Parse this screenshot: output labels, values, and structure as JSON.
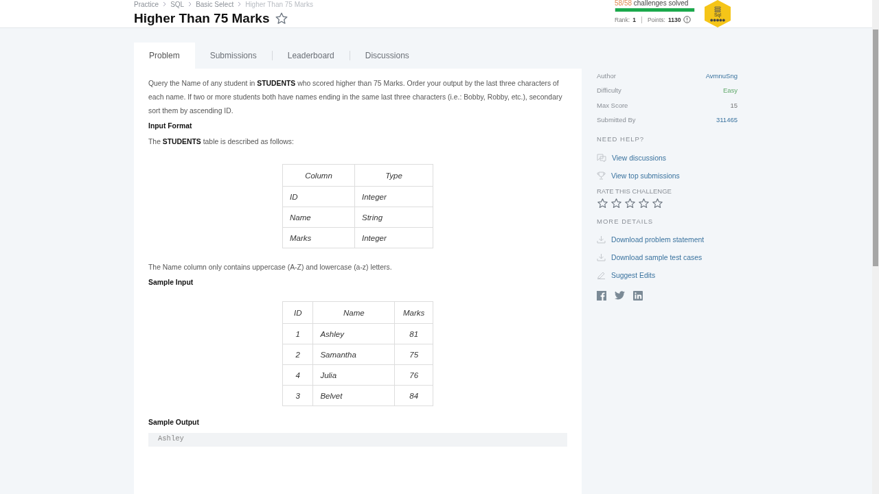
{
  "breadcrumb": [
    {
      "label": "Practice"
    },
    {
      "label": "SQL"
    },
    {
      "label": "Basic Select"
    },
    {
      "label": "Higher Than 75 Marks",
      "current": true
    }
  ],
  "title": "Higher Than 75 Marks",
  "stats": {
    "solved": "58/58",
    "solved_label": "challenges solved",
    "level": 1,
    "rank_label": "Rank:",
    "rank": "1",
    "points_label": "Points:",
    "points": "1130"
  },
  "badge": {
    "label": "Sql"
  },
  "tabs": [
    {
      "label": "Problem",
      "selected": true
    },
    {
      "label": "Submissions",
      "selected": false
    },
    {
      "label": "Leaderboard",
      "selected": false
    },
    {
      "label": "Discussions",
      "selected": false
    }
  ],
  "blocks": [
    {
      "kind": "paragraph",
      "text": "Query the Name of any student in **STUDENTS** who scored higher than 75 Marks. Order your output by the last three characters of each name. If two or more students both have names ending in the same last three characters (i.e.: Bobby, Robby, etc.), secondary sort them by ascending ID."
    },
    {
      "kind": "heading",
      "text": "Input Format"
    },
    {
      "kind": "paragraph",
      "text": "The **STUDENTS** table is described as follows:"
    },
    {
      "kind": "table",
      "columns": [
        "Column",
        "Type"
      ],
      "rows": [
        [
          "ID",
          "Integer"
        ],
        [
          "Name",
          "String"
        ],
        [
          "Marks",
          "Integer"
        ]
      ]
    },
    {
      "kind": "paragraph",
      "text": "The Name column only contains uppercase (A-Z) and lowercase (a-z) letters."
    },
    {
      "kind": "heading",
      "text": "Sample Input"
    },
    {
      "kind": "table",
      "columns": [
        "ID",
        "Name",
        "Marks"
      ],
      "rows": [
        [
          "1",
          "Ashley",
          "81"
        ],
        [
          "2",
          "Samantha",
          "75"
        ],
        [
          "4",
          "Julia",
          "76"
        ],
        [
          "3",
          "Belvet",
          "84"
        ]
      ]
    },
    {
      "kind": "heading",
      "text": "Sample Output"
    },
    {
      "kind": "code",
      "text": "Ashley"
    }
  ],
  "details": [
    {
      "label": "Author",
      "value": "AvmnuSng",
      "kind": "link"
    },
    {
      "label": "Difficulty",
      "value": "Easy",
      "kind": "difficulty"
    },
    {
      "label": "Max Score",
      "value": "15",
      "kind": "plain"
    },
    {
      "label": "Submitted By",
      "value": "311465",
      "kind": "link"
    }
  ],
  "help": {
    "heading": "NEED HELP?",
    "links": [
      {
        "label": "View discussions",
        "kind": "discussion"
      },
      {
        "label": "View top submissions",
        "kind": "trophy"
      }
    ]
  },
  "rating": {
    "heading": "RATE THIS CHALLENGE",
    "stars": 0
  },
  "more": {
    "heading": "MORE DETAILS",
    "links": [
      {
        "label": "Download problem statement",
        "kind": "download"
      },
      {
        "label": "Download sample test cases",
        "kind": "download"
      },
      {
        "label": "Suggest Edits",
        "kind": "edit"
      }
    ]
  }
}
